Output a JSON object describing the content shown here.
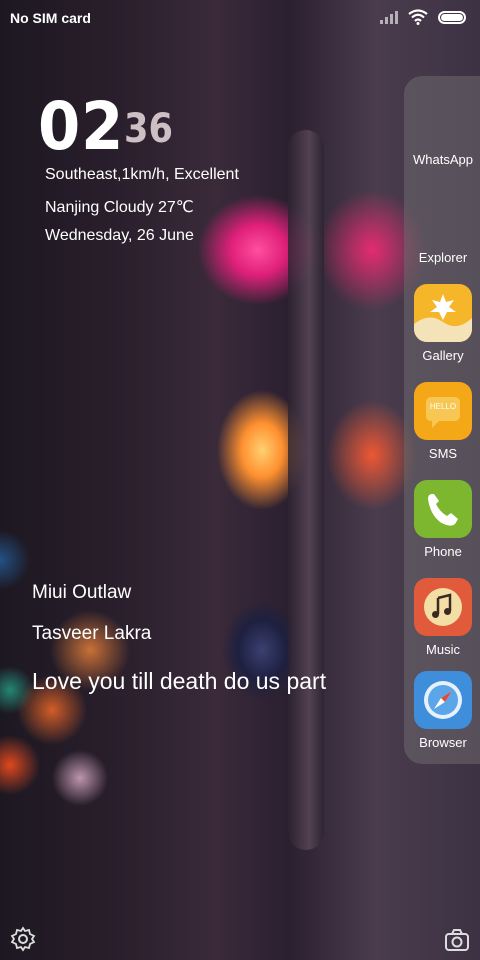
{
  "status_bar": {
    "carrier": "No SIM card"
  },
  "clock": {
    "hour": "02",
    "minute": "36"
  },
  "weather": {
    "wind_air": "Southeast,1km/h, Excellent",
    "location_condition_temp": "Nanjing  Cloudy  27℃",
    "date": "Wednesday, 26 June"
  },
  "lyrics": {
    "line1": "Miui Outlaw",
    "line2": "Tasveer Lakra",
    "line3": "Love you till death do us part"
  },
  "drawer": {
    "apps": [
      {
        "label": "WhatsApp",
        "icon": "whatsapp-icon"
      },
      {
        "label": "Explorer",
        "icon": "explorer-icon"
      },
      {
        "label": "Gallery",
        "icon": "gallery-icon"
      },
      {
        "label": "SMS",
        "icon": "sms-icon"
      },
      {
        "label": "Phone",
        "icon": "phone-icon"
      },
      {
        "label": "Music",
        "icon": "music-icon"
      },
      {
        "label": "Browser",
        "icon": "browser-icon"
      }
    ]
  },
  "sms_icon_text": "HELLO"
}
